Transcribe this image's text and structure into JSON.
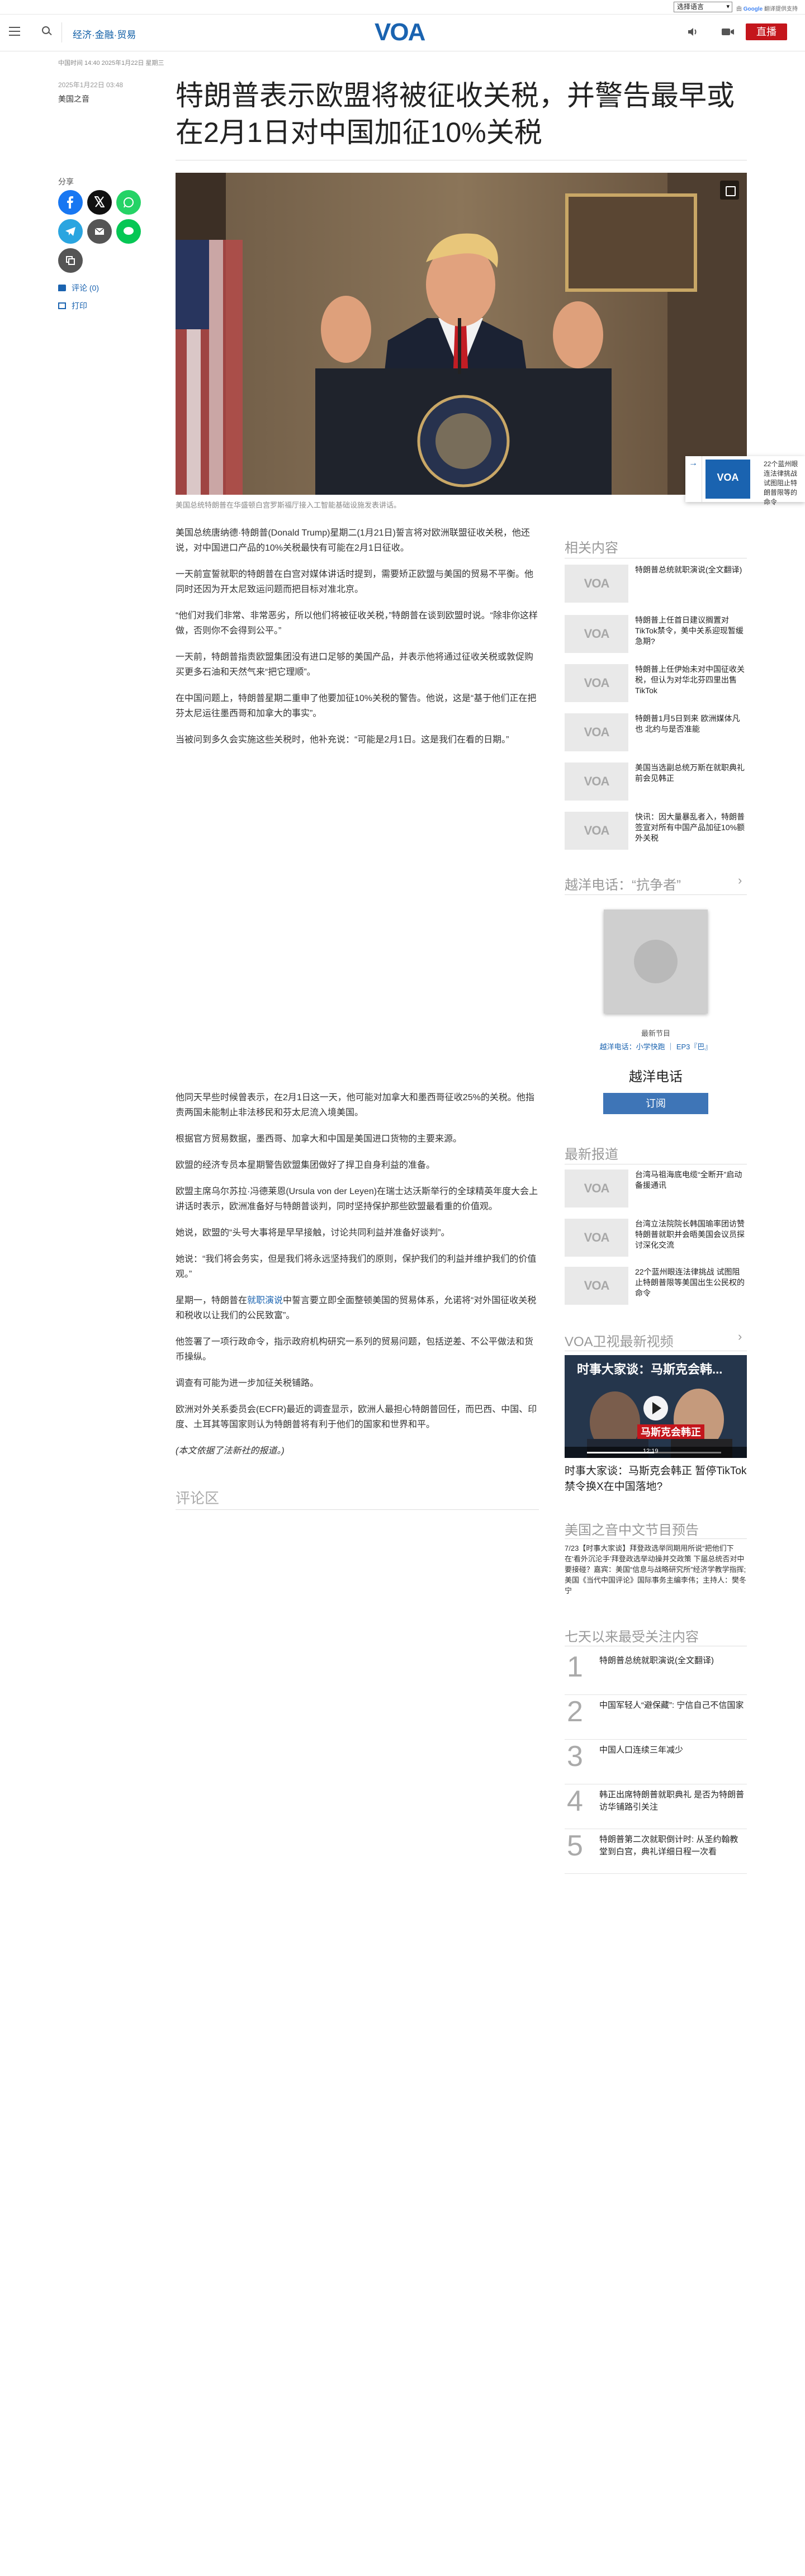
{
  "translate": {
    "select_label": "选择语言",
    "powered_prefix": "由",
    "powered_brand": "Google",
    "powered_suffix": "翻译提供支持"
  },
  "header": {
    "section": "经济·金融·贸易",
    "logo": "VOA",
    "live_label": "直播"
  },
  "article": {
    "dateline": "中国时间 14:40 2025年1月22日 星期三",
    "date": "2025年1月22日 03:48",
    "author": "美国之音",
    "title": "特朗普表示欧盟将被征收关税，并警告最早或在2月1日对中国加征10%关税",
    "caption": "美国总统特朗普在华盛顿白宫罗斯福厅接入工智能基础设施发表讲话。",
    "paragraphs_top": [
      "美国总统唐纳德·特朗普(Donald Trump)星期二(1月21日)誓言将对欧洲联盟征收关税，他还说，对中国进口产品的10%关税最快有可能在2月1日征收。",
      "一天前宣誓就职的特朗普在白宫对媒体讲话时提到，需要矫正欧盟与美国的贸易不平衡。他同时还因为开太尼致运问题而把目标对准北京。",
      "“他们对我们非常、非常恶劣，所以他们将被征收关税，”特朗普在谈到欧盟时说。“除非你这样做，否则你不会得到公平。”",
      "一天前，特朗普指责欧盟集团没有进口足够的美国产品，并表示他将通过征收关税或敦促购买更多石油和天然气来“把它理顺”。",
      "在中国问题上，特朗普星期二重申了他要加征10%关税的警告。他说，这是“基于他们正在把芬太尼运往墨西哥和加拿大的事实”。",
      "当被问到多久会实施这些关税时，他补充说：“可能是2月1日。这是我们在看的日期。”"
    ],
    "paragraphs_bottom": [
      "他同天早些时候曾表示，在2月1日这一天，他可能对加拿大和墨西哥征收25%的关税。他指责两国未能制止非法移民和芬太尼流入境美国。",
      "根据官方贸易数据，墨西哥、加拿大和中国是美国进口货物的主要来源。",
      "欧盟的经济专员本星期警告欧盟集团做好了捍卫自身利益的准备。",
      "欧盟主席乌尔苏拉·冯德莱恩(Ursula von der Leyen)在瑞士达沃斯举行的全球精英年度大会上讲话时表示，欧洲准备好与特朗普谈判，同时坚持保护那些欧盟最看重的价值观。",
      "她说，欧盟的“头号大事将是早早接触，讨论共同利益并准备好谈判”。",
      "她说：“我们将会务实，但是我们将永远坚持我们的原则，保护我们的利益并维护我们的价值观。”",
      "星期一，特朗普在就职演说中誓言要立即全面整顿美国的贸易体系，允诺将“对外国征收关税和税收以让我们的公民致富”。",
      "他签署了一项行政命令，指示政府机构研究一系列的贸易问题，包括逆差、不公平做法和货币操纵。",
      "调查有可能为进一步加征关税铺路。",
      "欧洲对外关系委员会(ECFR)最近的调查显示，欧洲人最担心特朗普回任，而巴西、中国、印度、土耳其等国家则认为特朗普将有利于他们的国家和世界和平。",
      "(本文依据了法新社的报道。)"
    ],
    "inaugural_link": "就职演说",
    "comments_heading": "评论区"
  },
  "share": {
    "label": "分享",
    "comments_link": "评论 (0)",
    "print_link": "打印"
  },
  "sidebar": {
    "related_heading": "相关内容",
    "related": [
      "特朗普总统就职演说(全文翻译)",
      "特朗普上任首日建议搁置对TikTok禁令，美中关系迎现暂缓急期?",
      "特朗普上任伊始未对中国征收关税，但认为对华北芬四里出售TikTok",
      "特朗普1月5日到来 欧洲媒体凡也 北约与是否准能",
      "美国当选副总统万斯在就职典礼前会见韩正",
      "快讯：因大量暴乱者入，特朗普签宣对所有中国产品加征10%额外关税"
    ],
    "podcast_heading": "越洋电话：“抗争者”",
    "podcast_latest": "最新节目",
    "podcast_episode": "越洋电话：小学快跑 ｜ EP3『巴』",
    "podcast_name": "越洋电话",
    "subscribe_label": "订阅",
    "latest_heading": "最新报道",
    "latest": [
      "台湾马祖海底电缆“全断开”启动备援通讯",
      "台湾立法院院长韩国瑜率团访赞特朗普就职并会晤美国会议员探讨深化交流",
      "22个蓝州眼连法律挑战 试图阻止特朗普限等美国出生公民权的命令"
    ],
    "video_heading": "VOA卫视最新视频",
    "video_overlay_title": "时事大家谈：马斯克会韩...",
    "video_overlay_sub": "马斯克会韩正",
    "video_time": "12:19",
    "video_title": "时事大家谈：马斯克会韩正 暂停TikTok禁令换X在中国落地?",
    "preview_heading": "美国之音中文节目预告",
    "preview_text": "7/23【时事大家谈】拜登政选举同期用所说“把他们下在‘看外沉沦手’拜登政选举动操并交政策 下届总统否对中要接碰？嘉宾：美国“信息与战略研究所”经济学教学指挥; 美国《当代中国评论》国际事务主编李伟；主持人：樊冬宁",
    "most_read_heading": "七天以来最受关注内容",
    "most_read": [
      {
        "num": "1",
        "text": "特朗普总统就职演说(全文翻译)"
      },
      {
        "num": "2",
        "text": "中国军轻人“避保藏”: 宁信自己不信国家"
      },
      {
        "num": "3",
        "text": "中国人口连续三年减少"
      },
      {
        "num": "4",
        "text": "韩正出席特朗普就职典礼 是否为特朗普访华铺路引关注"
      },
      {
        "num": "5",
        "text": "特朗普第二次就职倒计时: 从圣约翰教堂到白宫，典礼详细日程一次看"
      }
    ]
  },
  "float_card": {
    "text": "22个蓝州眼连法律挑战 试图阻止特朗普限等的命令"
  },
  "colors": {
    "brand_blue": "#1a63b0",
    "live_red": "#c4161c",
    "subscribe_blue": "#3e75b7"
  }
}
